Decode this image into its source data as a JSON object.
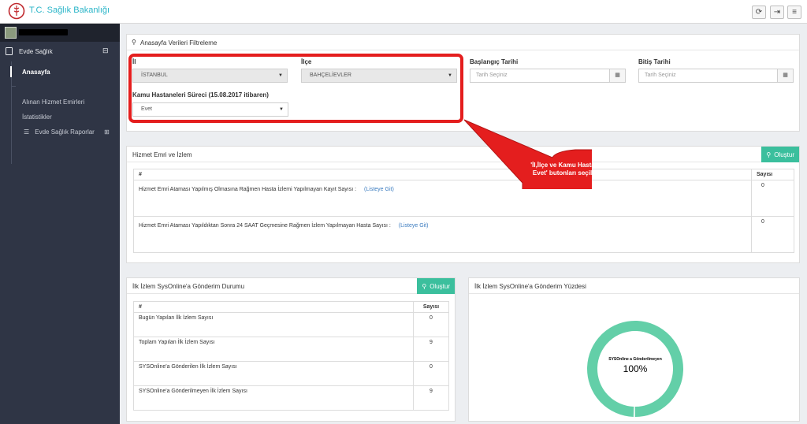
{
  "header": {
    "brand": "T.C. Sağlık Bakanlığı"
  },
  "sidebar": {
    "section_label": "Evde Sağlık",
    "toggle_symbol": "⊟",
    "items": [
      {
        "label": "Anasayfa",
        "active": true
      },
      {
        "label": "Alınan Hizmet Emirleri",
        "active": false
      },
      {
        "label": "İstatistikler",
        "active": false
      },
      {
        "label": "Evde Sağlık Raporlar",
        "active": false,
        "expand_symbol": "⊞"
      }
    ]
  },
  "filter_panel": {
    "title": "Anasayfa Verileri Filtreleme",
    "il_label": "İl",
    "il_value": "İSTANBUL",
    "ilce_label": "İlçe",
    "ilce_value": "BAHÇELİEVLER",
    "start_label": "Başlangıç Tarihi",
    "start_placeholder": "Tarih Seçiniz",
    "end_label": "Bitiş Tarihi",
    "end_placeholder": "Tarih Seçiniz",
    "kamu_label": "Kamu Hastaneleri Süreci (15.08.2017 itibaren)",
    "kamu_value": "Evet"
  },
  "hizmet_panel": {
    "title": "Hizmet Emri ve İzlem",
    "create_label": "Oluştur",
    "col_hash": "#",
    "col_count": "Sayısı",
    "rows": [
      {
        "text": "Hizmet Emri Ataması Yapılmış Olmasına Rağmen Hasta İzlemi Yapılmayan Kayıt Sayısı :",
        "link": "(Listeye Git)",
        "count": "0"
      },
      {
        "text": "Hizmet Emri Ataması Yapıldıktan Sonra 24 SAAT Geçmesine Rağmen İzlem Yapılmayan Hasta Sayısı :",
        "link": "(Listeye Git)",
        "count": "0"
      }
    ]
  },
  "sysonline_panel": {
    "title": "İlk İzlem SysOnline'a Gönderim Durumu",
    "create_label": "Oluştur",
    "col_hash": "#",
    "col_count": "Sayısı",
    "rows": [
      {
        "label": "Bugün Yapılan İlk İzlem Sayısı",
        "count": "0"
      },
      {
        "label": "Toplam Yapılan İlk İzlem Sayısı",
        "count": "9"
      },
      {
        "label": "SYSOnline'a Gönderilen İlk İzlem Sayısı",
        "count": "0"
      },
      {
        "label": "SYSOnline'a Gönderilmeyen İlk İzlem Sayısı",
        "count": "9"
      }
    ]
  },
  "percent_panel": {
    "title": "İlk İzlem SysOnline'a Gönderim Yüzdesi"
  },
  "chart_data": {
    "type": "pie",
    "categories": [
      "SYSOnline a Gönderilmeyen"
    ],
    "values": [
      100
    ],
    "center_label": "SYSOnline a Gönderilmeyen",
    "center_value": "100%",
    "color": "#63cfa8"
  },
  "annotation": {
    "callout_text": "'İl,İlçe ve Kamu Hastaneleri Süreci Evet' butonları seçili olarak gelir.",
    "color": "#e41e1e"
  }
}
